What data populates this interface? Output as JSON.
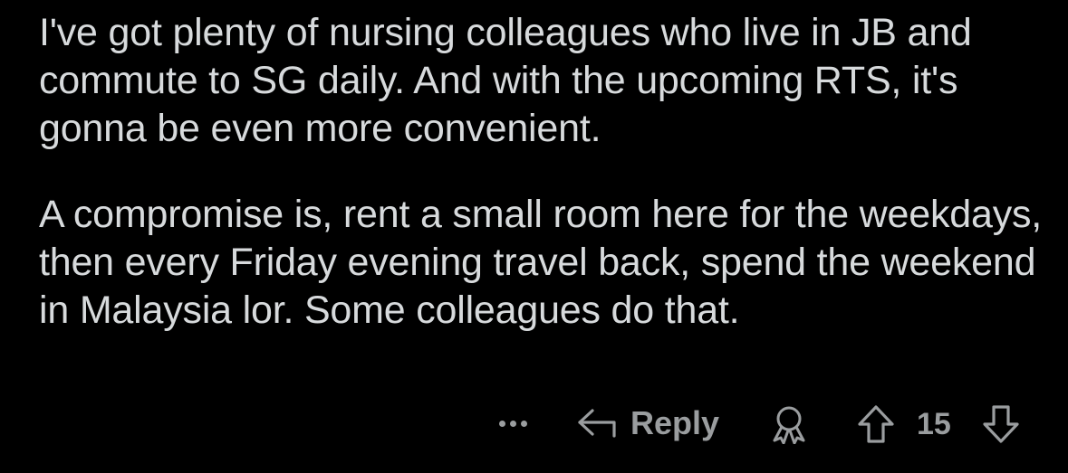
{
  "comment": {
    "paragraphs": [
      "I've got plenty of nursing colleagues who live in JB and commute to SG daily. And with the upcoming RTS, it's gonna be even more convenient.",
      "A compromise is, rent a small room here for the weekdays, then every Friday evening travel back, spend the weekend in Malaysia lor. Some colleagues do that."
    ]
  },
  "actions": {
    "more_icon": "more-dots-icon",
    "reply_icon": "reply-arrow-icon",
    "reply_label": "Reply",
    "award_icon": "award-icon",
    "upvote_icon": "upvote-arrow-icon",
    "score": "15",
    "downvote_icon": "downvote-arrow-icon"
  },
  "colors": {
    "background": "#000000",
    "text": "#d7dadc",
    "muted": "#9a9d9f"
  }
}
